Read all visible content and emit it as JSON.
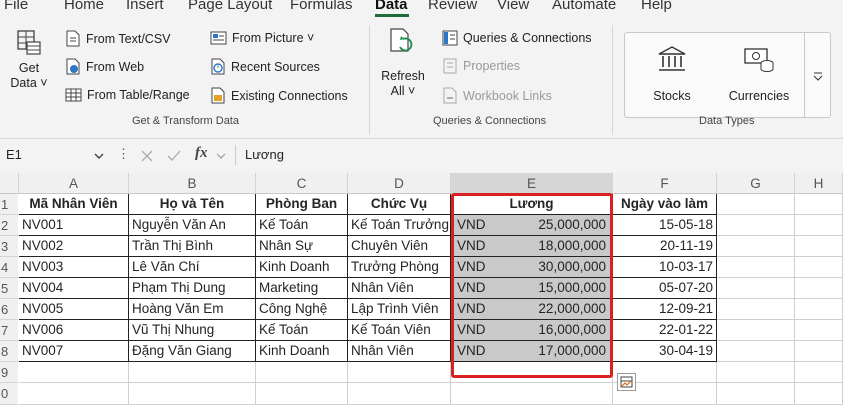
{
  "tabs": [
    "File",
    "Home",
    "Insert",
    "Page Layout",
    "Formulas",
    "Data",
    "Review",
    "View",
    "Automate",
    "Help"
  ],
  "active_tab": "Data",
  "ribbon": {
    "get_data": {
      "line1": "Get",
      "line2": "Data ˅"
    },
    "get_transform_items": [
      "From Text/CSV",
      "From Web",
      "From Table/Range"
    ],
    "get_transform_items2": [
      "From Picture ˅",
      "Recent Sources",
      "Existing Connections"
    ],
    "get_transform_label": "Get & Transform Data",
    "refresh": {
      "line1": "Refresh",
      "line2": "All ˅"
    },
    "queries_items": [
      "Queries & Connections",
      "Properties",
      "Workbook Links"
    ],
    "queries_label": "Queries & Connections",
    "stocks": "Stocks",
    "currencies": "Currencies",
    "data_types_label": "Data Types"
  },
  "formula_bar": {
    "name_box": "E1",
    "fx": "fx",
    "value": "Lương"
  },
  "columns": [
    "A",
    "B",
    "C",
    "D",
    "E",
    "F",
    "G",
    "H"
  ],
  "rows": [
    "1",
    "2",
    "3",
    "4",
    "5",
    "6",
    "7",
    "8",
    "9",
    "0"
  ],
  "headers": [
    "Mã Nhân Viên",
    "Họ và Tên",
    "Phòng Ban",
    "Chức Vụ",
    "Lương",
    "Ngày vào làm"
  ],
  "currency": "VND",
  "table": [
    [
      "NV001",
      "Nguyễn Văn An",
      "Kế Toán",
      "Kế Toán Trưởng",
      "25,000,000",
      "15-05-18"
    ],
    [
      "NV002",
      "Trần Thị Bình",
      "Nhân Sự",
      "Chuyên Viên",
      "18,000,000",
      "20-11-19"
    ],
    [
      "NV003",
      "Lê Văn Chí",
      "Kinh Doanh",
      "Trưởng Phòng",
      "30,000,000",
      "10-03-17"
    ],
    [
      "NV004",
      "Phạm Thị Dung",
      "Marketing",
      "Nhân Viên",
      "15,000,000",
      "05-07-20"
    ],
    [
      "NV005",
      "Hoàng Văn Em",
      "Công Nghệ",
      "Lập Trình Viên",
      "22,000,000",
      "12-09-21"
    ],
    [
      "NV006",
      "Vũ Thị Nhung",
      "Kế Toán",
      "Kế Toán Viên",
      "16,000,000",
      "22-01-22"
    ],
    [
      "NV007",
      "Đặng Văn Giang",
      "Kinh Doanh",
      "Nhân Viên",
      "17,000,000",
      "30-04-19"
    ]
  ],
  "colors": {
    "accent": "#1f6b3a",
    "highlight": "#d92121",
    "selected_fill": "#c9c9c9"
  }
}
